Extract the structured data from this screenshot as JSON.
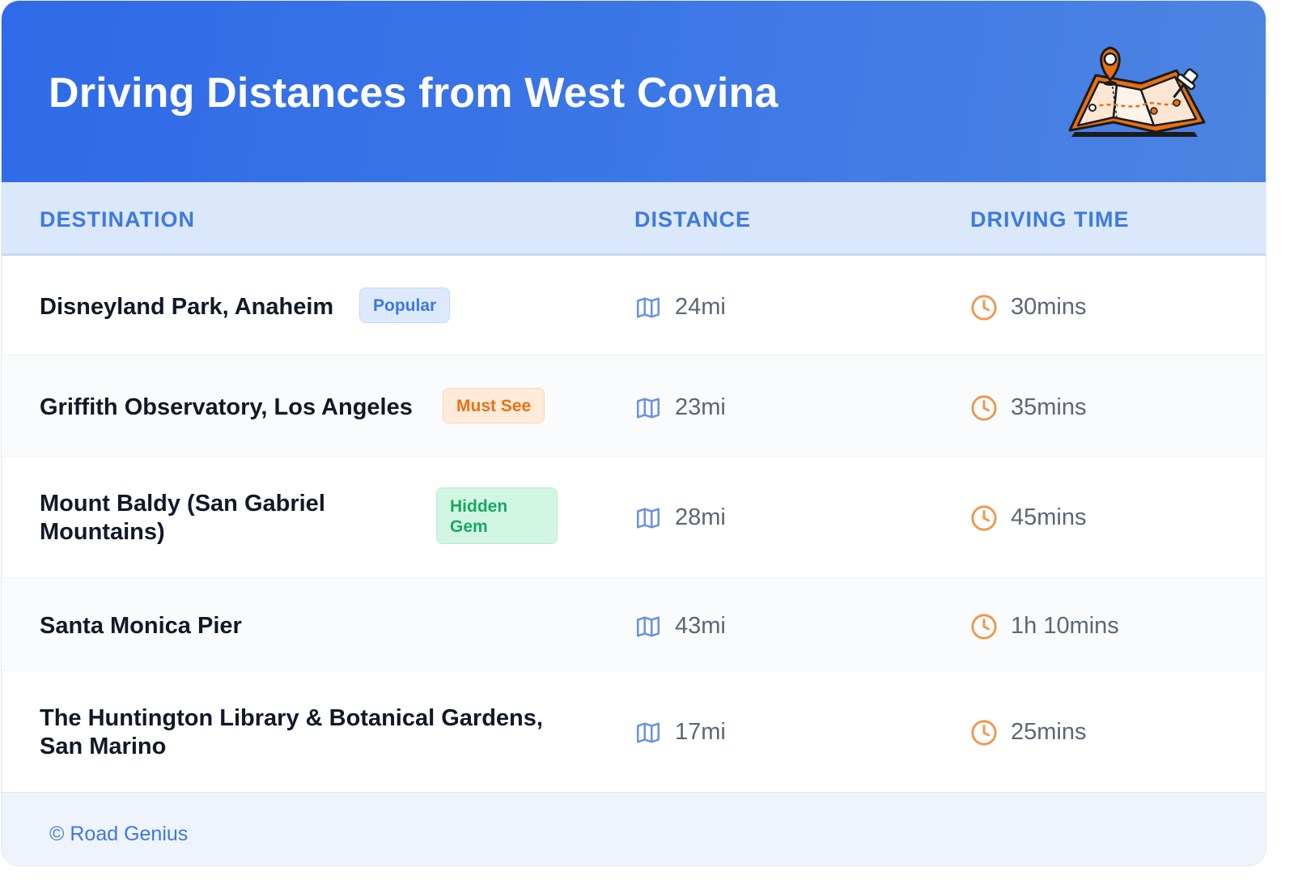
{
  "header": {
    "title": "Driving Distances from West Covina",
    "illustration_icon": "map-with-pins-icon"
  },
  "columns": {
    "destination": "DESTINATION",
    "distance": "DISTANCE",
    "driving_time": "DRIVING TIME"
  },
  "rows": [
    {
      "destination": "Disneyland Park, Anaheim",
      "badge": "Popular",
      "badge_color": "#3d78e0",
      "distance": "24mi",
      "time": "30mins"
    },
    {
      "destination": "Griffith Observatory, Los Angeles",
      "badge": "Must See",
      "badge_color": "#ea6f13",
      "distance": "23mi",
      "time": "35mins"
    },
    {
      "destination_line1": "Mount Baldy (San Gabriel",
      "destination_line2": "Mountains)",
      "badge_line1": "Hidden",
      "badge_line2": "Gem",
      "badge_color": "#18a862",
      "distance": "28mi",
      "time": "45mins"
    },
    {
      "destination": "Santa Monica Pier",
      "distance": "43mi",
      "time": "1h 10mins"
    },
    {
      "destination_line1": "The Huntington Library & Botanical Gardens,",
      "destination_line2": "San Marino",
      "distance": "17mi",
      "time": "25mins"
    }
  ],
  "icons": {
    "distance": "map-icon",
    "time": "clock-icon"
  },
  "colors": {
    "header_bg": "#2f6ae8",
    "column_header_bg": "#dbe8fc",
    "accent_blue": "#3d78e0",
    "clock_orange": "#f0954a"
  },
  "footer": {
    "text": "© Road Genius"
  }
}
